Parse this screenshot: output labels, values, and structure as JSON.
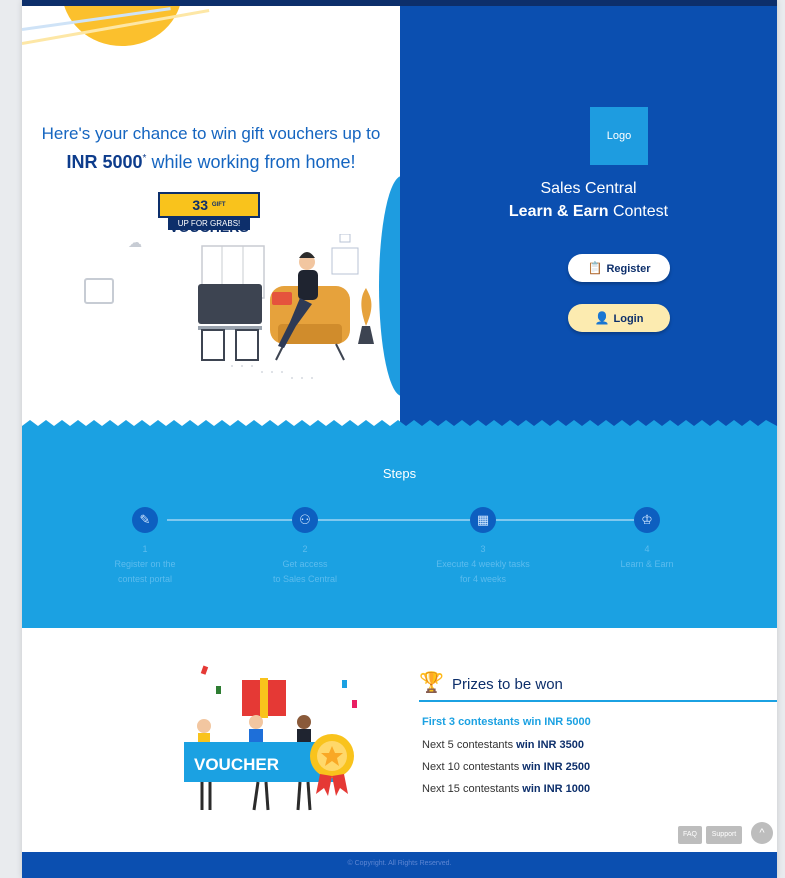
{
  "hero": {
    "headline_line1": "Here's your chance to win gift vouchers up to",
    "headline_amount": "INR 5000",
    "headline_mark": "*",
    "headline_rest": " while working from home!",
    "badge_count": "33",
    "badge_gift": "GIFT",
    "badge_word": "VOUCHERS",
    "badge_sub": "UP FOR GRABS!"
  },
  "brand": {
    "logo_text": "Logo",
    "title_line1": "Sales Central",
    "title_bold": "Learn & Earn",
    "title_rest": " Contest",
    "register_label": "Register",
    "login_label": "Login"
  },
  "steps": {
    "title": "Steps",
    "items": [
      {
        "number": "1",
        "text_line1": "Register on the",
        "text_line2": "contest portal",
        "icon": "register-icon"
      },
      {
        "number": "2",
        "text_line1": "Get access",
        "text_line2": "to Sales Central",
        "icon": "user-access-icon"
      },
      {
        "number": "3",
        "text_line1": "Execute 4 weekly tasks",
        "text_line2": "for 4 weeks",
        "icon": "calendar-icon"
      },
      {
        "number": "4",
        "text_line1": "Learn & Earn",
        "text_line2": "",
        "icon": "trophy-icon"
      }
    ]
  },
  "prizes": {
    "title": "Prizes to be won",
    "voucher_label": "VOUCHER",
    "rows": [
      {
        "prefix": "First 3 contestants",
        "suffix": " win INR 5000"
      },
      {
        "prefix": "Next 5 contestants ",
        "suffix": "win INR 3500"
      },
      {
        "prefix": "Next 10 contestants ",
        "suffix": "win INR 2500"
      },
      {
        "prefix": "Next 15 contestants ",
        "suffix": "win INR 1000"
      }
    ]
  },
  "utility": {
    "faq_label": "FAQ",
    "support_label": "Support",
    "top_glyph": "^"
  },
  "footer": {
    "copyright": "© Copyright. All Rights Reserved."
  },
  "colors": {
    "primary_blue": "#0b4fb0",
    "steps_blue": "#1ba1e2",
    "voucher_yellow": "#f9c31c",
    "navy": "#0d2f6b"
  }
}
